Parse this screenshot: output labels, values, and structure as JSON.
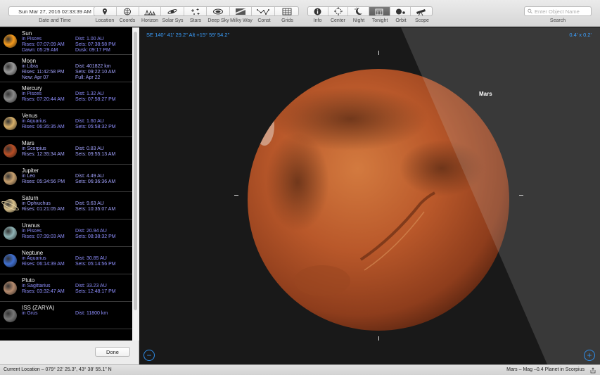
{
  "toolbar": {
    "date_time": "Sun Mar 27, 2016  02:33:39 AM",
    "date_time_label": "Date and Time",
    "buttons_left": [
      {
        "label": "Location",
        "icon": "location-pin-icon"
      },
      {
        "label": "Coords",
        "icon": "coords-icon"
      },
      {
        "label": "Horizon",
        "icon": "horizon-icon"
      },
      {
        "label": "Solar Sys",
        "icon": "solar-system-icon"
      },
      {
        "label": "Stars",
        "icon": "stars-icon"
      },
      {
        "label": "Deep Sky",
        "icon": "deep-sky-icon"
      },
      {
        "label": "Milky Way",
        "icon": "milky-way-icon"
      },
      {
        "label": "Const",
        "icon": "constellation-icon"
      },
      {
        "label": "Grids",
        "icon": "grids-icon"
      }
    ],
    "buttons_right": [
      {
        "label": "Info",
        "icon": "info-icon"
      },
      {
        "label": "Center",
        "icon": "center-icon"
      },
      {
        "label": "Night",
        "icon": "night-icon"
      },
      {
        "label": "Tonight",
        "icon": "tonight-icon"
      },
      {
        "label": "Orbit",
        "icon": "orbit-icon"
      },
      {
        "label": "Scope",
        "icon": "telescope-icon"
      }
    ],
    "search_placeholder": "Enter Object Name",
    "search_label": "Search"
  },
  "objects": [
    {
      "name": "Sun",
      "loc": "in Pisces",
      "a": "Rises: 07:07:09 AM",
      "b": "Dawn: 05:29 AM",
      "dist": "Dist: 1.00 AU",
      "sets": "Sets: 07:38:58 PM",
      "d": "Dusk: 09:17 PM",
      "color": "#f59a1c",
      "highlight": false
    },
    {
      "name": "Moon",
      "loc": "in Libra",
      "a": "Rises: 11:42:58 PM",
      "b": "New: Apr 07",
      "dist": "Dist: 401822 km",
      "sets": "Sets: 09:22:10 AM",
      "d": "Full: Apr 22",
      "color": "#9a9a9a",
      "highlight": true
    },
    {
      "name": "Mercury",
      "loc": "in Pisces",
      "a": "Rises: 07:20:44 AM",
      "b": "",
      "dist": "Dist: 1.32 AU",
      "sets": "Sets: 07:58:27 PM",
      "d": "",
      "color": "#8a8a8a",
      "highlight": false
    },
    {
      "name": "Venus",
      "loc": "in Aquarius",
      "a": "Rises: 06:35:35 AM",
      "b": "",
      "dist": "Dist: 1.60 AU",
      "sets": "Sets: 05:58:32 PM",
      "d": "",
      "color": "#d8b06a",
      "highlight": false
    },
    {
      "name": "Mars",
      "loc": "in Scorpius",
      "a": "Rises: 12:35:34 AM",
      "b": "",
      "dist": "Dist: 0.83 AU",
      "sets": "Sets: 09:55:13 AM",
      "d": "",
      "color": "#b84e25",
      "highlight": true
    },
    {
      "name": "Jupiter",
      "loc": "in Leo",
      "a": "Rises: 05:34:56 PM",
      "b": "",
      "dist": "Dist: 4.49 AU",
      "sets": "Sets: 06:36:36 AM",
      "d": "",
      "color": "#c9a16f",
      "highlight": true
    },
    {
      "name": "Saturn",
      "loc": "in Ophiuchus",
      "a": "Rises: 01:21:05 AM",
      "b": "",
      "dist": "Dist: 9.63 AU",
      "sets": "Sets: 10:35:07 AM",
      "d": "",
      "color": "#d8c08a",
      "highlight": true
    },
    {
      "name": "Uranus",
      "loc": "in Pisces",
      "a": "Rises: 07:39:03 AM",
      "b": "",
      "dist": "Dist: 20.94 AU",
      "sets": "Sets: 08:38:32 PM",
      "d": "",
      "color": "#8fb4b6",
      "highlight": false
    },
    {
      "name": "Neptune",
      "loc": "in Aquarius",
      "a": "Rises: 06:14:39 AM",
      "b": "",
      "dist": "Dist: 30.85 AU",
      "sets": "Sets: 05:14:56 PM",
      "d": "",
      "color": "#3f6fd0",
      "highlight": false
    },
    {
      "name": "Pluto",
      "loc": "in Sagittarius",
      "a": "Rises: 03:32:47 AM",
      "b": "",
      "dist": "Dist: 33.23 AU",
      "sets": "Sets: 12:48:17 PM",
      "d": "",
      "color": "#b58b6e",
      "highlight": false
    },
    {
      "name": "ISS (ZARYA)",
      "loc": "in Grus",
      "a": "",
      "b": "",
      "dist": "Dist: 11800 km",
      "sets": "",
      "d": "",
      "color": "#777777",
      "highlight": false
    }
  ],
  "panel": {
    "done_label": "Done"
  },
  "sky": {
    "coords": "SE 140° 41' 29.2\" Alt +15° 59' 54.2\"",
    "fov": "0.4' x 0.2'",
    "object_label": "Mars",
    "zoom_out": "−",
    "zoom_in": "+"
  },
  "status": {
    "location": "Current Location – 079° 22' 25.3\", 43° 38' 55.1\" N",
    "selection": "Mars – Mag –0.4 Planet in Scorpius"
  }
}
